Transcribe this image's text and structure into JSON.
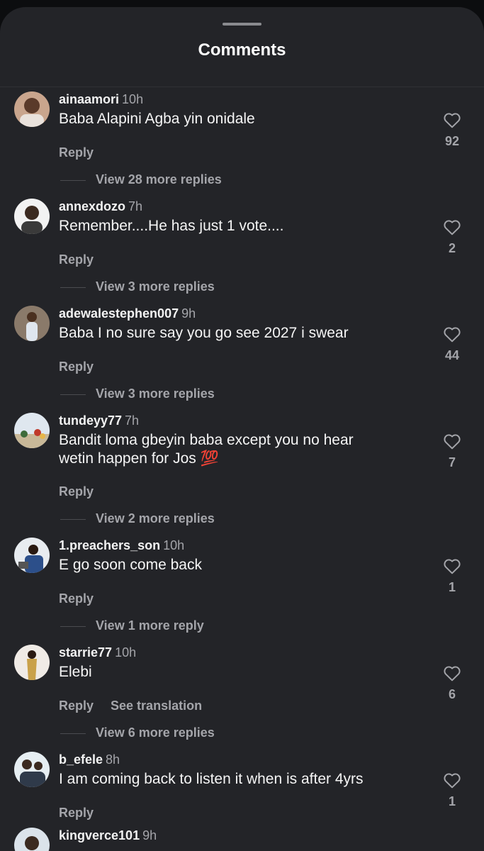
{
  "header": {
    "title": "Comments"
  },
  "comments": [
    {
      "username": "ainaamori",
      "time": "10h",
      "text": "Baba Alapini Agba yin onidale",
      "reply": "Reply",
      "likes": "92",
      "view_replies": "View 28 more replies"
    },
    {
      "username": "annexdozo",
      "time": "7h",
      "text": "Remember....He has just 1 vote....",
      "reply": "Reply",
      "likes": "2",
      "view_replies": "View 3 more replies"
    },
    {
      "username": "adewalestephen007",
      "time": "9h",
      "text": "Baba I no sure say you go see 2027 i swear",
      "reply": "Reply",
      "likes": "44",
      "view_replies": "View 3 more replies"
    },
    {
      "username": "tundeyy77",
      "time": "7h",
      "text": "Bandit loma gbeyin baba except you no hear wetin happen for Jos 💯",
      "reply": "Reply",
      "likes": "7",
      "view_replies": "View 2 more replies"
    },
    {
      "username": "1.preachers_son",
      "time": "10h",
      "text": "E go soon come back",
      "reply": "Reply",
      "likes": "1",
      "view_replies": "View 1 more reply"
    },
    {
      "username": "starrie77",
      "time": "10h",
      "text": "Elebi",
      "reply": "Reply",
      "translate": "See translation",
      "likes": "6",
      "view_replies": "View 6 more replies"
    },
    {
      "username": "b_efele",
      "time": "8h",
      "text": "I am coming back to listen it when is after 4yrs",
      "reply": "Reply",
      "likes": "1"
    },
    {
      "username": "kingverce101",
      "time": "9h"
    }
  ],
  "icons": {
    "like": "heart-outline-icon"
  },
  "colors": {
    "background": "#232428",
    "muted": "#a4a5aa"
  }
}
